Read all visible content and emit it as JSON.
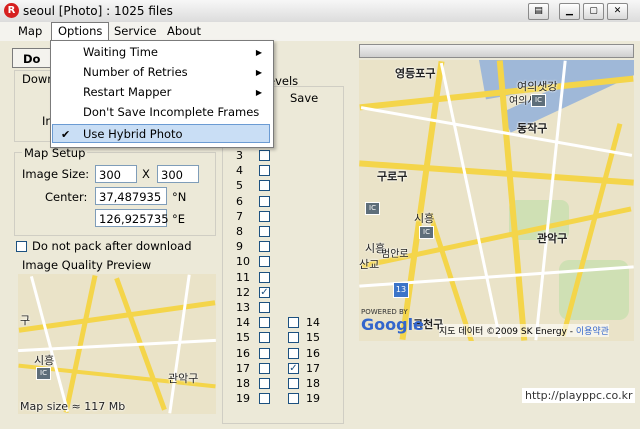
{
  "window": {
    "title": "seoul [Photo] : 1025 files",
    "app_icon_letter": "R"
  },
  "menubar": {
    "items": [
      "Map",
      "Options",
      "Service",
      "About"
    ]
  },
  "options_menu": {
    "items": [
      {
        "label": "Waiting Time",
        "submenu": true
      },
      {
        "label": "Number of Retries",
        "submenu": true
      },
      {
        "label": "Restart Mapper",
        "submenu": true
      },
      {
        "label": "Don't Save Incomplete Frames",
        "submenu": false
      },
      {
        "label": "Use Hybrid Photo",
        "checked": true,
        "highlighted": true
      }
    ]
  },
  "download_panel": {
    "button_label": "Do",
    "label_down": "Down",
    "label_in": "In",
    "levels_label": "evels",
    "save_label": "Save"
  },
  "map_setup": {
    "title": "Map Setup",
    "image_size_label": "Image Size:",
    "width": "300",
    "x_label": "X",
    "height": "300",
    "center_label": "Center:",
    "lat": "37,487935",
    "lat_unit": "°N",
    "lon": "126,925735",
    "lon_unit": "°E"
  },
  "no_pack": {
    "label": "Do not pack after download",
    "checked": false
  },
  "preview": {
    "title": "Image Quality Preview",
    "map_size": "Map size ≈ 117 Mb",
    "labels": [
      "구",
      "시흥",
      "관악구"
    ]
  },
  "levels": {
    "download": [
      {
        "level": "3",
        "checked": false
      },
      {
        "level": "4",
        "checked": false
      },
      {
        "level": "5",
        "checked": false
      },
      {
        "level": "6",
        "checked": false
      },
      {
        "level": "7",
        "checked": false
      },
      {
        "level": "8",
        "checked": false
      },
      {
        "level": "9",
        "checked": false
      },
      {
        "level": "10",
        "checked": false
      },
      {
        "level": "11",
        "checked": false
      },
      {
        "level": "12",
        "checked": true
      },
      {
        "level": "13",
        "checked": false
      },
      {
        "level": "14",
        "checked": false
      },
      {
        "level": "15",
        "checked": false
      },
      {
        "level": "16",
        "checked": false
      },
      {
        "level": "17",
        "checked": false
      },
      {
        "level": "18",
        "checked": false
      },
      {
        "level": "19",
        "checked": false
      }
    ],
    "save": [
      {
        "level": "14",
        "checked": false
      },
      {
        "level": "15",
        "checked": false
      },
      {
        "level": "16",
        "checked": false
      },
      {
        "level": "17",
        "checked": true
      },
      {
        "level": "18",
        "checked": false
      },
      {
        "level": "19",
        "checked": false
      }
    ]
  },
  "map": {
    "labels": [
      "영등포구",
      "여의샛강",
      "여의서로",
      "동작구",
      "구로구",
      "시흥",
      "관악구",
      "시흥",
      "범안로",
      "산교",
      "금천구"
    ],
    "route_badge": "13",
    "powered_by": "POWERED BY",
    "google": "Google",
    "copyright": "지도 데이터 ©2009 SK Energy - ",
    "terms": "이용약관"
  },
  "watermark": "http://playppc.co.kr"
}
